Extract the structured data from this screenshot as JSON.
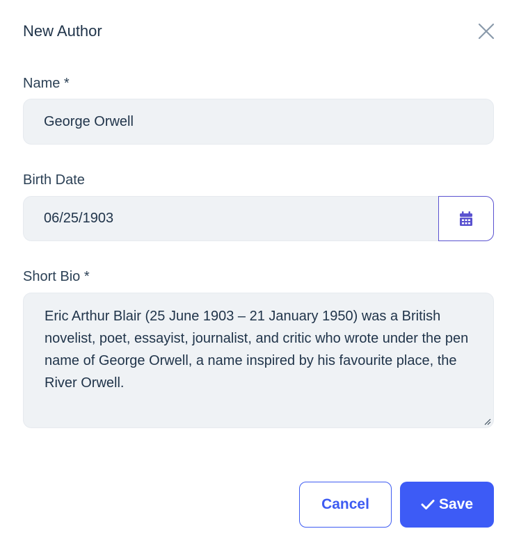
{
  "dialog": {
    "title": "New Author",
    "close_icon": "close-icon"
  },
  "form": {
    "name": {
      "label": "Name *",
      "value": "George Orwell"
    },
    "birth_date": {
      "label": "Birth Date",
      "value": "06/25/1903",
      "calendar_icon": "calendar-icon"
    },
    "short_bio": {
      "label": "Short Bio *",
      "value": "Eric Arthur Blair (25 June 1903 – 21 January 1950) was a British novelist, poet, essayist, journalist, and critic who wrote under the pen name of George Orwell, a name inspired by his favourite place, the River Orwell."
    }
  },
  "actions": {
    "cancel_label": "Cancel",
    "save_label": "Save",
    "save_icon": "check-icon"
  },
  "colors": {
    "accent": "#3d5bf6",
    "calendar_accent": "#5a52d0",
    "input_bg": "#eff2f5",
    "text": "#1f3349"
  }
}
